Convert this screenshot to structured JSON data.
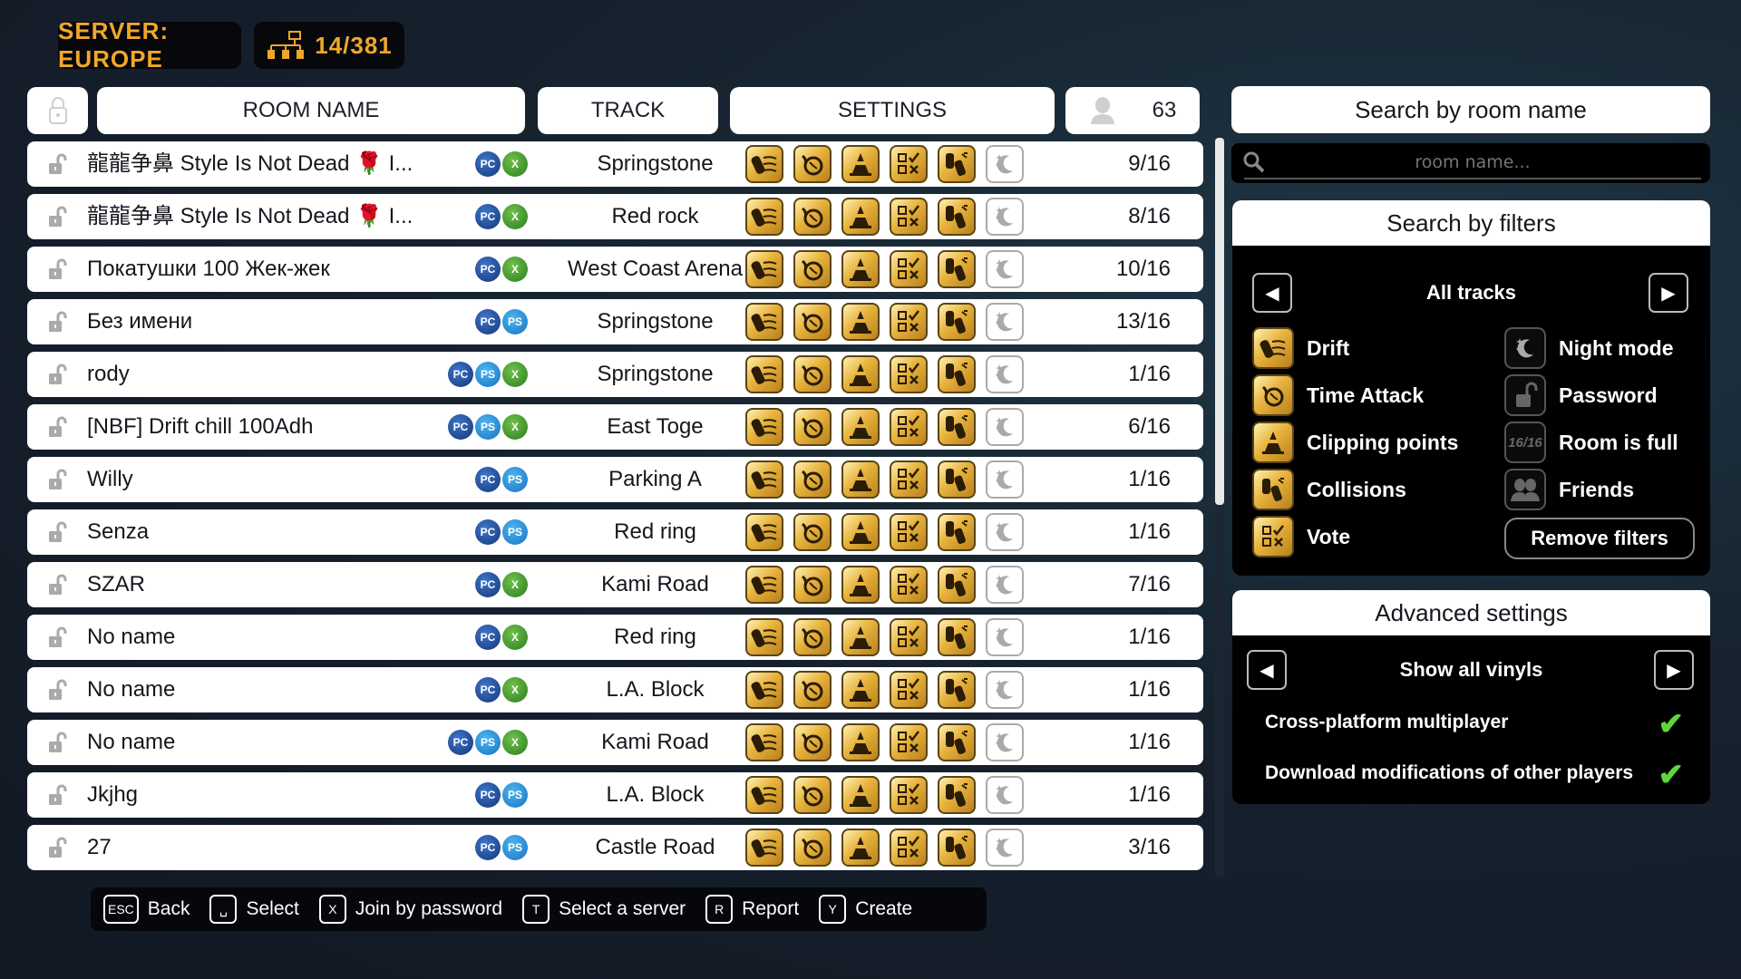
{
  "top": {
    "server_label": "SERVER: EUROPE",
    "rooms_count": "14/381",
    "network_icon": "network-icon"
  },
  "header": {
    "lock_icon": "lock-icon",
    "room_name": "ROOM NAME",
    "track": "TRACK",
    "settings": "SETTINGS",
    "players_icon": "player-icon",
    "players_total": "63"
  },
  "rooms": [
    {
      "name": "龍龍争鼻 Style Is Not Dead 🌹 I...",
      "platforms": [
        "pc",
        "xbox"
      ],
      "track": "Springstone",
      "players": "9/16"
    },
    {
      "name": "龍龍争鼻 Style Is Not Dead 🌹 I...",
      "platforms": [
        "pc",
        "xbox"
      ],
      "track": "Red rock",
      "players": "8/16"
    },
    {
      "name": "Покатушки 100 Жек-жек",
      "platforms": [
        "pc",
        "xbox"
      ],
      "track": "West Coast Arena",
      "players": "10/16"
    },
    {
      "name": "Без имени",
      "platforms": [
        "pc",
        "playstation"
      ],
      "track": "Springstone",
      "players": "13/16"
    },
    {
      "name": "rody",
      "platforms": [
        "pc",
        "playstation",
        "xbox"
      ],
      "track": "Springstone",
      "players": "1/16"
    },
    {
      "name": "[NBF] Drift chill 100Adh",
      "platforms": [
        "pc",
        "playstation",
        "xbox"
      ],
      "track": "East Toge",
      "players": "6/16"
    },
    {
      "name": "Willy",
      "platforms": [
        "pc",
        "playstation"
      ],
      "track": "Parking A",
      "players": "1/16"
    },
    {
      "name": "Senza",
      "platforms": [
        "pc",
        "playstation"
      ],
      "track": "Red ring",
      "players": "1/16"
    },
    {
      "name": "SZAR",
      "platforms": [
        "pc",
        "xbox"
      ],
      "track": "Kami Road",
      "players": "7/16"
    },
    {
      "name": "No name",
      "platforms": [
        "pc",
        "xbox"
      ],
      "track": "Red ring",
      "players": "1/16"
    },
    {
      "name": "No name",
      "platforms": [
        "pc",
        "xbox"
      ],
      "track": "L.A. Block",
      "players": "1/16"
    },
    {
      "name": "No name",
      "platforms": [
        "pc",
        "playstation",
        "xbox"
      ],
      "track": "Kami Road",
      "players": "1/16"
    },
    {
      "name": "Jkjhg",
      "platforms": [
        "pc",
        "playstation"
      ],
      "track": "L.A. Block",
      "players": "1/16"
    },
    {
      "name": "27",
      "platforms": [
        "pc",
        "playstation"
      ],
      "track": "Castle Road",
      "players": "3/16"
    }
  ],
  "platform_labels": {
    "pc": "PC",
    "playstation": "PS",
    "xbox": "X"
  },
  "setting_icons": [
    "drift-icon",
    "time-attack-icon",
    "clipping-points-icon",
    "vote-icon",
    "collisions-icon",
    "night-mode-icon"
  ],
  "search": {
    "title": "Search by room name",
    "placeholder": "room name...",
    "value": ""
  },
  "filters": {
    "title": "Search by filters",
    "track_selector": "All tracks",
    "left": [
      {
        "label": "Drift",
        "icon": "drift-icon"
      },
      {
        "label": "Time Attack",
        "icon": "time-attack-icon"
      },
      {
        "label": "Clipping points",
        "icon": "clipping-points-icon"
      },
      {
        "label": "Collisions",
        "icon": "collisions-icon"
      },
      {
        "label": "Vote",
        "icon": "vote-icon"
      }
    ],
    "right": [
      {
        "label": "Night mode",
        "icon": "night-mode-icon"
      },
      {
        "label": "Password",
        "icon": "unlock-icon"
      },
      {
        "label": "Room is full",
        "icon": "room-full-icon",
        "glyph": "16/16"
      },
      {
        "label": "Friends",
        "icon": "friends-icon"
      }
    ],
    "remove_label": "Remove filters"
  },
  "advanced": {
    "title": "Advanced settings",
    "vinyls_selector": "Show all vinyls",
    "options": [
      {
        "label": "Cross-platform multiplayer",
        "checked": true
      },
      {
        "label": "Download modifications of other players",
        "checked": true
      }
    ],
    "accent_check": "#5fd63a"
  },
  "hints": [
    {
      "key": "ESC",
      "label": "Back"
    },
    {
      "key": "␣",
      "label": "Select"
    },
    {
      "key": "X",
      "label": "Join by password"
    },
    {
      "key": "T",
      "label": "Select a server"
    },
    {
      "key": "R",
      "label": "Report"
    },
    {
      "key": "Y",
      "label": "Create"
    }
  ],
  "colors": {
    "accent": "#f0a72a",
    "panel": "#000000",
    "row": "#ffffff"
  }
}
